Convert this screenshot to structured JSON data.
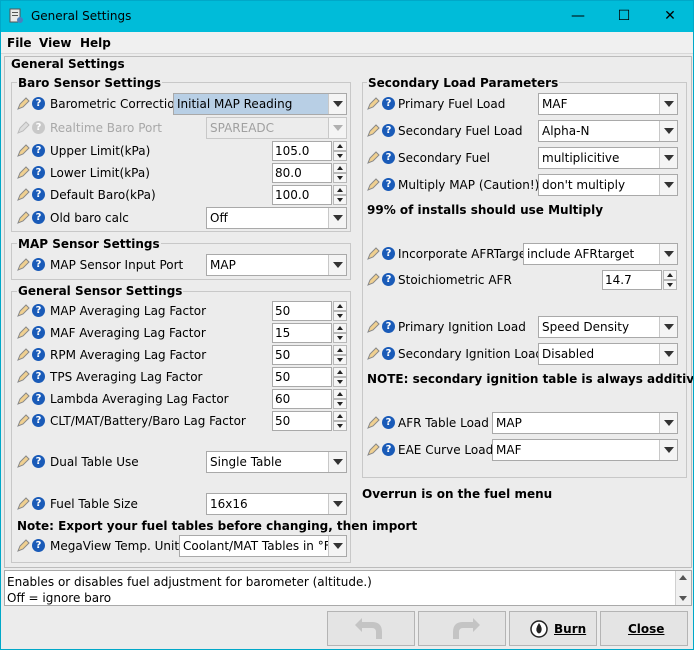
{
  "window": {
    "title": "General Settings",
    "minimize": "—",
    "maximize": "☐",
    "close": "✕"
  },
  "menu": [
    "File",
    "View",
    "Help"
  ],
  "main_group_title": "General Settings",
  "baro": {
    "title": "Baro Sensor Settings",
    "barometric_correction": {
      "label": "Barometric Correction",
      "value": "Initial MAP Reading"
    },
    "realtime_baro_port": {
      "label": "Realtime Baro Port",
      "value": "SPAREADC"
    },
    "upper_limit": {
      "label": "Upper Limit(kPa)",
      "value": "105.0"
    },
    "lower_limit": {
      "label": "Lower Limit(kPa)",
      "value": "80.0"
    },
    "default_baro": {
      "label": "Default Baro(kPa)",
      "value": "100.0"
    },
    "old_baro_calc": {
      "label": "Old baro calc",
      "value": "Off"
    }
  },
  "map_sensor": {
    "title": "MAP Sensor Settings",
    "input_port": {
      "label": "MAP Sensor Input Port",
      "value": "MAP"
    }
  },
  "general_sensor": {
    "title": "General Sensor Settings",
    "rows": [
      {
        "label": "MAP Averaging Lag Factor",
        "value": "50"
      },
      {
        "label": "MAF Averaging Lag Factor",
        "value": "15"
      },
      {
        "label": "RPM Averaging Lag Factor",
        "value": "50"
      },
      {
        "label": "TPS Averaging Lag Factor",
        "value": "50"
      },
      {
        "label": "Lambda Averaging Lag Factor",
        "value": "60"
      },
      {
        "label": "CLT/MAT/Battery/Baro Lag Factor",
        "value": "50"
      }
    ],
    "dual_table_use": {
      "label": "Dual Table Use",
      "value": "Single Table"
    },
    "fuel_table_size": {
      "label": "Fuel Table Size",
      "value": "16x16"
    },
    "note": "Note: Export your fuel tables before changing, then import",
    "megaview_units": {
      "label": "MegaView Temp. Units",
      "value": "Coolant/MAT Tables in °F"
    }
  },
  "secondary": {
    "title": "Secondary Load Parameters",
    "primary_fuel_load": {
      "label": "Primary Fuel Load",
      "value": "MAF"
    },
    "secondary_fuel_load": {
      "label": "Secondary Fuel Load",
      "value": "Alpha-N"
    },
    "secondary_fuel": {
      "label": "Secondary Fuel",
      "value": "multiplicitive"
    },
    "multiply_map": {
      "label": "Multiply MAP (Caution!)",
      "value": "don't multiply"
    },
    "note1": "99% of installs should use Multiply",
    "incorporate_afr": {
      "label": "Incorporate AFRTarget",
      "value": "include AFRtarget"
    },
    "stoich_afr": {
      "label": "Stoichiometric AFR",
      "value": "14.7"
    },
    "primary_ign_load": {
      "label": "Primary Ignition Load",
      "value": "Speed Density"
    },
    "secondary_ign_load": {
      "label": "Secondary Ignition Load",
      "value": "Disabled"
    },
    "note2": "NOTE: secondary ignition table is always additive",
    "afr_table_load": {
      "label": "AFR Table Load",
      "value": "MAP"
    },
    "eae_curve_load": {
      "label": "EAE Curve Load",
      "value": "MAF"
    }
  },
  "overrun_note": "Overrun is on the fuel menu",
  "status": {
    "line1": "Enables or disables fuel adjustment for barometer (altitude.)",
    "line2": "Off = ignore baro"
  },
  "buttons": {
    "burn": "Burn",
    "close": "Close"
  }
}
